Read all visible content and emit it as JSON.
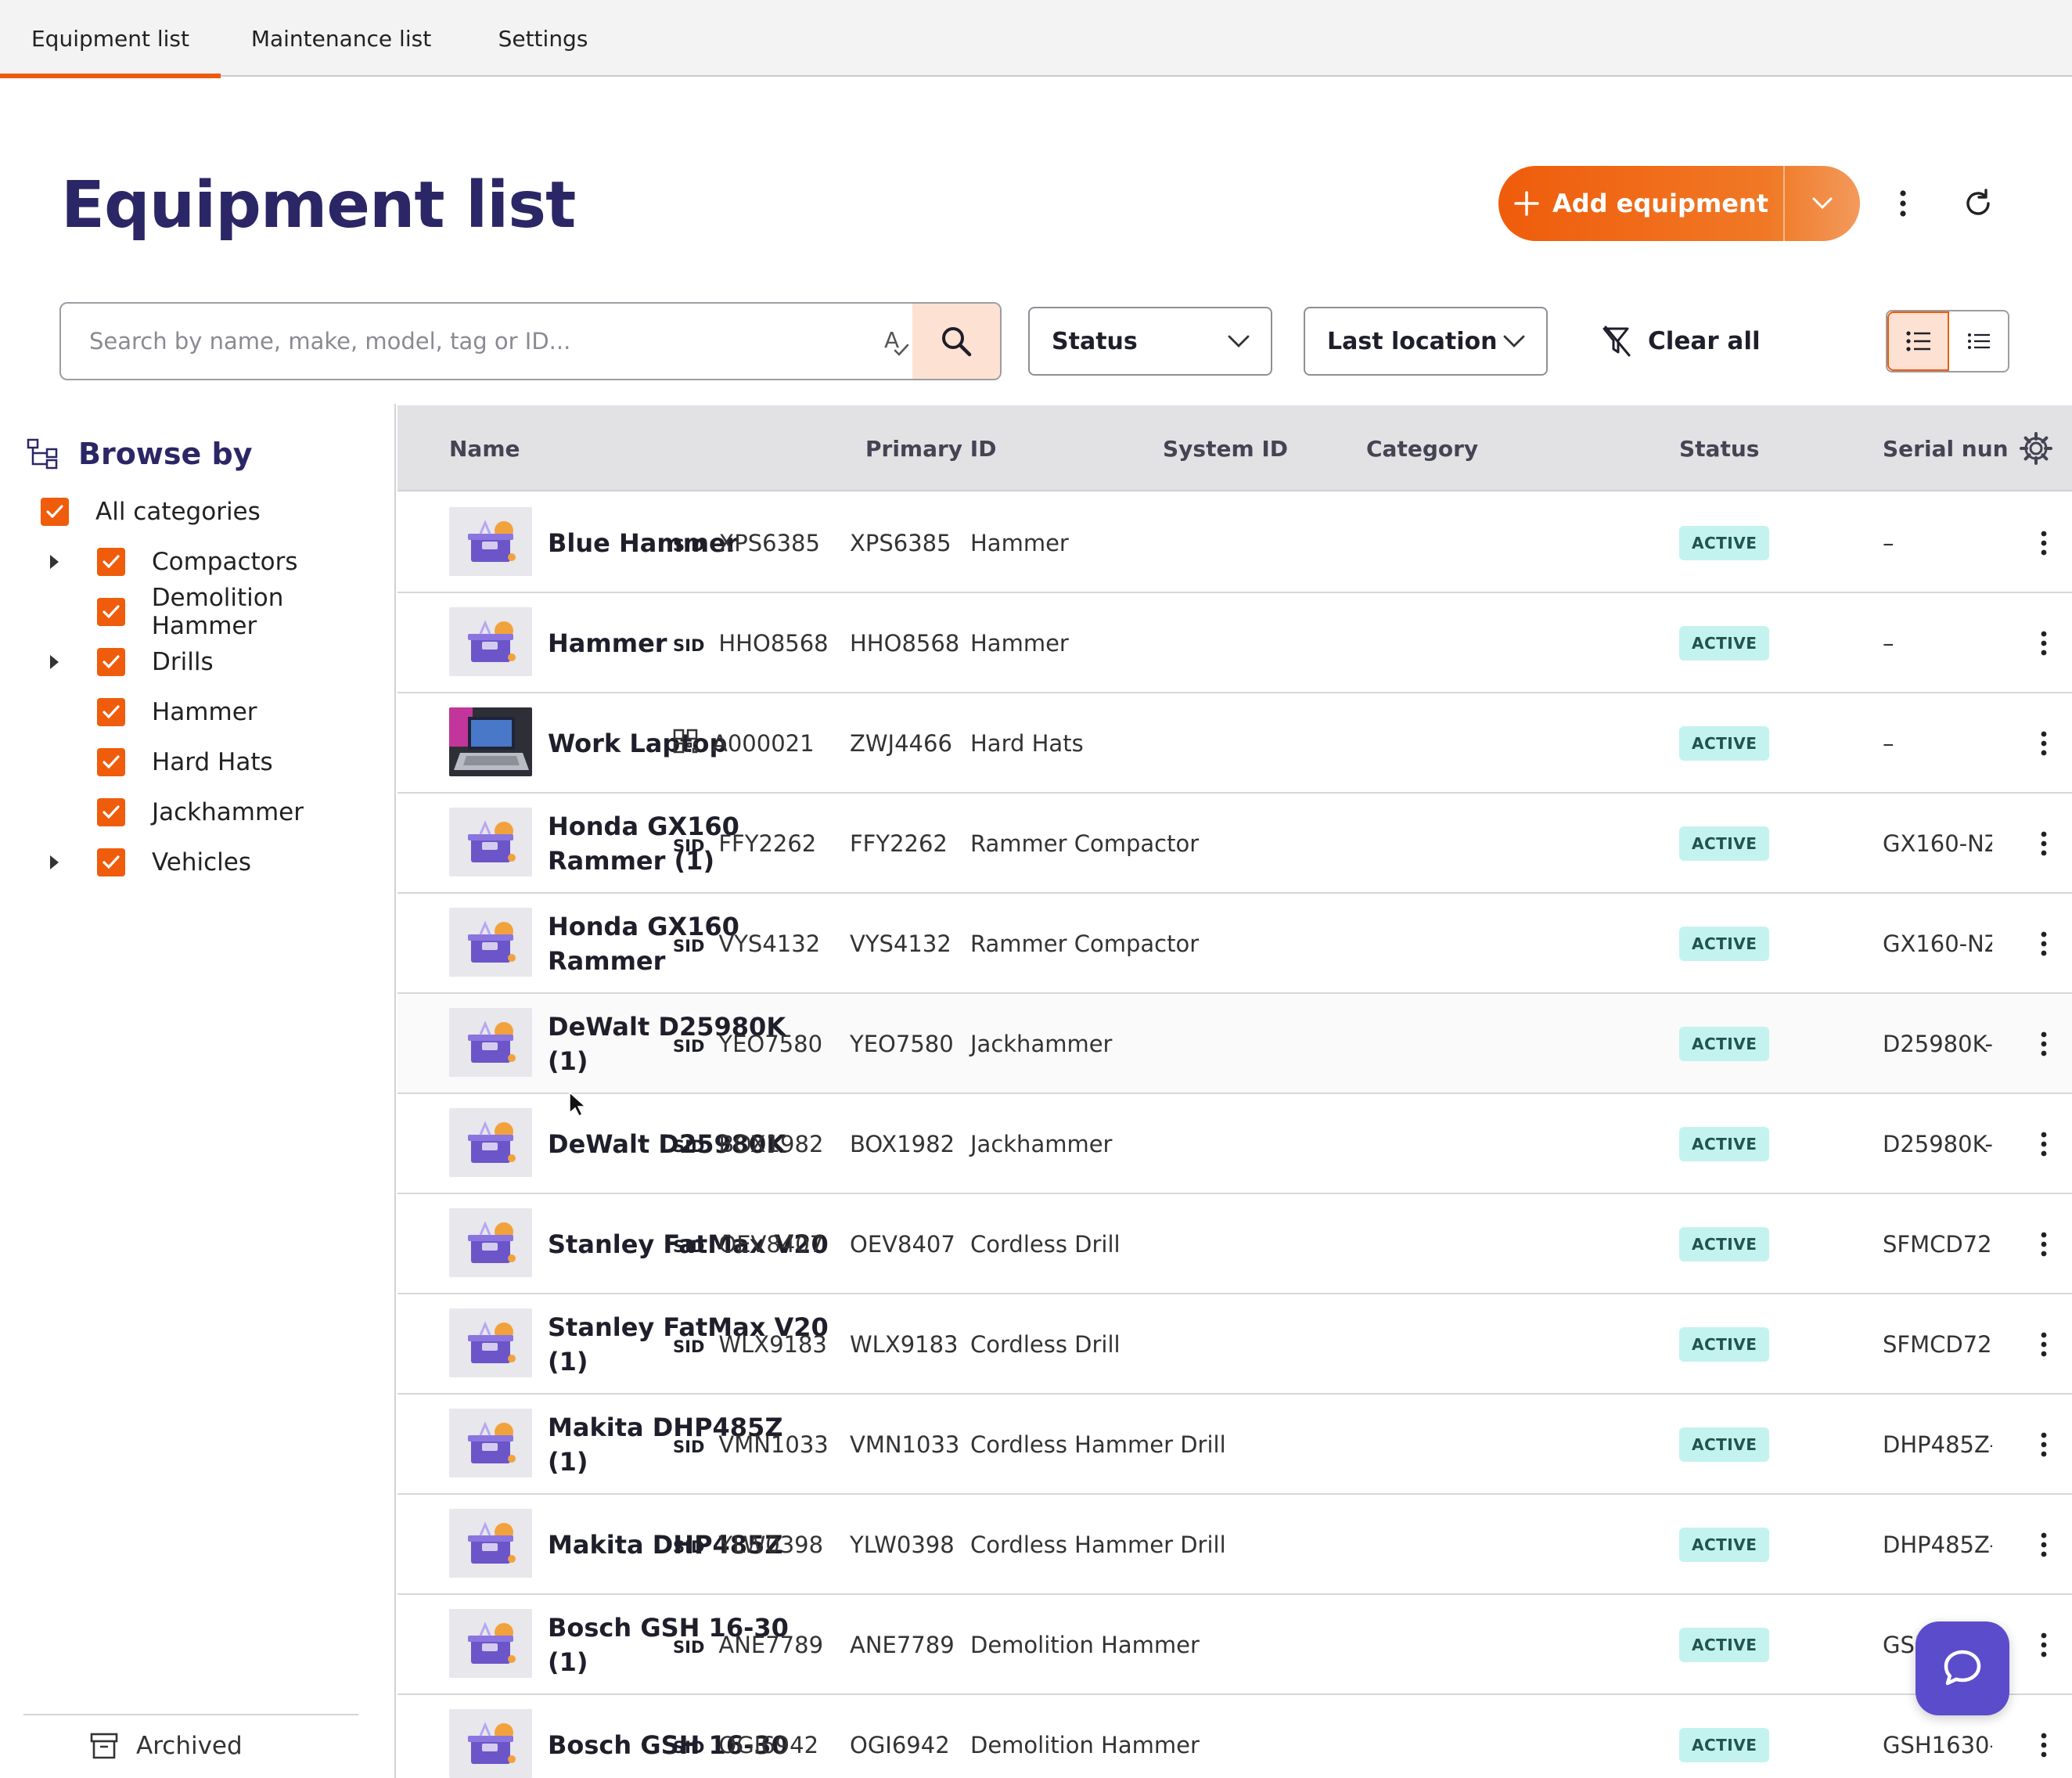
{
  "tabs": [
    {
      "label": "Equipment list",
      "active": true
    },
    {
      "label": "Maintenance list",
      "active": false
    },
    {
      "label": "Settings",
      "active": false
    }
  ],
  "header": {
    "title": "Equipment list",
    "add_button_label": "Add equipment",
    "accent_color": "#ee5a10",
    "title_color": "#2b2766"
  },
  "filters": {
    "search_placeholder": "Search by name, make, model, tag or ID...",
    "search_value": "",
    "status_label": "Status",
    "location_label": "Last location",
    "clear_label": "Clear all"
  },
  "sidebar": {
    "browse_label": "Browse by",
    "all_label": "All categories",
    "categories": [
      {
        "label": "Compactors",
        "expandable": true,
        "checked": true
      },
      {
        "label": "Demolition Hammer",
        "expandable": false,
        "checked": true
      },
      {
        "label": "Drills",
        "expandable": true,
        "checked": true
      },
      {
        "label": "Hammer",
        "expandable": false,
        "checked": true
      },
      {
        "label": "Hard Hats",
        "expandable": false,
        "checked": true
      },
      {
        "label": "Jackhammer",
        "expandable": false,
        "checked": true
      },
      {
        "label": "Vehicles",
        "expandable": true,
        "checked": true
      }
    ],
    "archived_label": "Archived"
  },
  "table": {
    "columns": [
      "Name",
      "Primary ID",
      "System ID",
      "Category",
      "Status",
      "Serial nun"
    ],
    "sid_tag": "SID",
    "rows": [
      {
        "name": "Blue Hammer",
        "id_type": "sid",
        "primary_id": "XPS6385",
        "system_id": "XPS6385",
        "category": "Hammer",
        "status": "ACTIVE",
        "serial": "–",
        "thumb": "toolbox-icon"
      },
      {
        "name": "Hammer",
        "id_type": "sid",
        "primary_id": "HHO8568",
        "system_id": "HHO8568",
        "category": "Hammer",
        "status": "ACTIVE",
        "serial": "–",
        "thumb": "toolbox-icon"
      },
      {
        "name": "Work Laptop",
        "id_type": "qr",
        "primary_id": "A000021",
        "system_id": "ZWJ4466",
        "category": "Hard Hats",
        "status": "ACTIVE",
        "serial": "–",
        "thumb": "laptop-photo"
      },
      {
        "name": "Honda GX160 Rammer (1)",
        "id_type": "sid",
        "primary_id": "FFY2262",
        "system_id": "FFY2262",
        "category": "Rammer Compactor",
        "status": "ACTIVE",
        "serial": "GX160-NZ",
        "thumb": "toolbox-icon"
      },
      {
        "name": "Honda GX160 Rammer",
        "id_type": "sid",
        "primary_id": "VYS4132",
        "system_id": "VYS4132",
        "category": "Rammer Compactor",
        "status": "ACTIVE",
        "serial": "GX160-NZ",
        "thumb": "toolbox-icon"
      },
      {
        "name": "DeWalt D25980K (1)",
        "id_type": "sid",
        "primary_id": "YEO7580",
        "system_id": "YEO7580",
        "category": "Jackhammer",
        "status": "ACTIVE",
        "serial": "D25980K-",
        "thumb": "toolbox-icon"
      },
      {
        "name": "DeWalt D25980K",
        "id_type": "sid",
        "primary_id": "BOX1982",
        "system_id": "BOX1982",
        "category": "Jackhammer",
        "status": "ACTIVE",
        "serial": "D25980K-",
        "thumb": "toolbox-icon"
      },
      {
        "name": "Stanley FatMax V20",
        "id_type": "sid",
        "primary_id": "OEV8407",
        "system_id": "OEV8407",
        "category": "Cordless Drill",
        "status": "ACTIVE",
        "serial": "SFMCD72:",
        "thumb": "toolbox-icon"
      },
      {
        "name": "Stanley FatMax V20 (1)",
        "id_type": "sid",
        "primary_id": "WLX9183",
        "system_id": "WLX9183",
        "category": "Cordless Drill",
        "status": "ACTIVE",
        "serial": "SFMCD72:",
        "thumb": "toolbox-icon"
      },
      {
        "name": "Makita DHP485Z (1)",
        "id_type": "sid",
        "primary_id": "VMN1033",
        "system_id": "VMN1033",
        "category": "Cordless Hammer Drill",
        "status": "ACTIVE",
        "serial": "DHP485Z-",
        "thumb": "toolbox-icon"
      },
      {
        "name": "Makita DHP485Z",
        "id_type": "sid",
        "primary_id": "YLW0398",
        "system_id": "YLW0398",
        "category": "Cordless Hammer Drill",
        "status": "ACTIVE",
        "serial": "DHP485Z-",
        "thumb": "toolbox-icon"
      },
      {
        "name": "Bosch GSH 16-30 (1)",
        "id_type": "sid",
        "primary_id": "ANE7789",
        "system_id": "ANE7789",
        "category": "Demolition Hammer",
        "status": "ACTIVE",
        "serial": "GSH",
        "thumb": "toolbox-icon"
      },
      {
        "name": "Bosch GSH 16-30",
        "id_type": "sid",
        "primary_id": "OGI6942",
        "system_id": "OGI6942",
        "category": "Demolition Hammer",
        "status": "ACTIVE",
        "serial": "GSH1630-",
        "thumb": "toolbox-icon"
      }
    ]
  },
  "colors": {
    "status_active_bg": "#c4f3ef",
    "chat_button": "#5b4ccc"
  }
}
